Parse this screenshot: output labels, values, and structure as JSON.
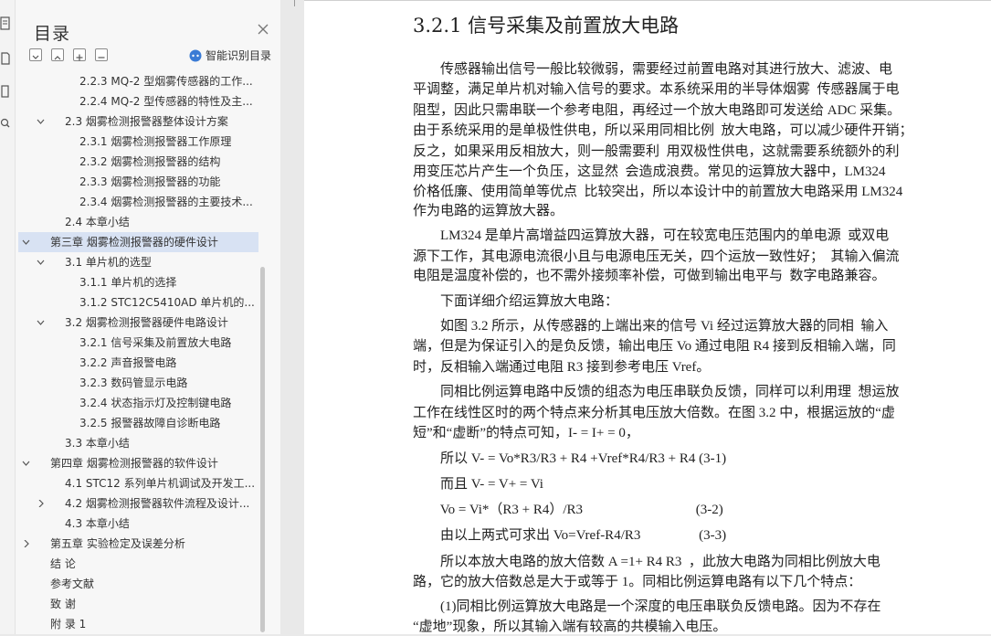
{
  "sidebar": {
    "title": "目录",
    "smart_label": "智能识别目录",
    "items": [
      {
        "label": "2.2.3 MQ-2 型烟雾传感器的工作...",
        "level": 3
      },
      {
        "label": "2.2.4 MQ-2 型传感器的特性及主...",
        "level": 3
      },
      {
        "label": "2.3 烟雾检测报警器整体设计方案",
        "level": 2,
        "expanded": true
      },
      {
        "label": "2.3.1 烟雾检测报警器工作原理",
        "level": 3
      },
      {
        "label": "2.3.2 烟雾检测报警器的结构",
        "level": 3
      },
      {
        "label": "2.3.3 烟雾检测报警器的功能",
        "level": 3
      },
      {
        "label": "2.3.4 烟雾检测报警器的主要技术...",
        "level": 3
      },
      {
        "label": "2.4 本章小结",
        "level": 2
      },
      {
        "label": "第三章  烟雾检测报警器的硬件设计",
        "level": 1,
        "expanded": true,
        "selected": true
      },
      {
        "label": "3.1 单片机的选型",
        "level": 2,
        "expanded": true
      },
      {
        "label": "3.1.1 单片机的选择",
        "level": 3
      },
      {
        "label": "3.1.2 STC12C5410AD 单片机的...",
        "level": 3
      },
      {
        "label": "3.2 烟雾检测报警器硬件电路设计",
        "level": 2,
        "expanded": true
      },
      {
        "label": "3.2.1 信号采集及前置放大电路",
        "level": 3
      },
      {
        "label": "3.2.2 声音报警电路",
        "level": 3
      },
      {
        "label": "3.2.3 数码管显示电路",
        "level": 3
      },
      {
        "label": "3.2.4 状态指示灯及控制键电路",
        "level": 3
      },
      {
        "label": "3.2.5 报警器故障自诊断电路",
        "level": 3
      },
      {
        "label": "3.3 本章小结",
        "level": 2
      },
      {
        "label": "第四章  烟雾检测报警器的软件设计",
        "level": 1,
        "expanded": true
      },
      {
        "label": "4.1 STC12 系列单片机调试及开发工...",
        "level": 2
      },
      {
        "label": "4.2 烟雾检测报警器软件流程及设计...",
        "level": 2,
        "collapsed": true
      },
      {
        "label": "4.3 本章小结",
        "level": 2
      },
      {
        "label": "第五章  实验检定及误差分析",
        "level": 1,
        "collapsed": true
      },
      {
        "label": "结  论",
        "level": 1
      },
      {
        "label": "参考文献",
        "level": 1
      },
      {
        "label": "致  谢",
        "level": 1
      },
      {
        "label": "附  录 1",
        "level": 1
      }
    ]
  },
  "document": {
    "heading": "3.2.1 信号采集及前置放大电路",
    "paragraph_lines": [
      "        传感器输出信号一般比较微弱，需要经过前置电路对其进行放大、滤波、电",
      "平调整，满足单片机对输入信号的要求。本系统采用的半导体烟雾  传感器属于电",
      "阻型，因此只需串联一个参考电阻，再经过一个放大电路即可发送给 ADC 采集。",
      "由于系统采用的是单极性供电，所以采用同相比例  放大电路，可以减少硬件开销；",
      "反之，如果采用反相放大，则一般需要利  用双极性供电，这就需要系统额外的利",
      "用变压芯片产生一个负压，这显然  会造成浪费。常见的运算放大器中，LM324",
      "价格低廉、使用简单等优点  比较突出，所以本设计中的前置放大电路采用 LM324",
      "作为电路的运算放大器。",
      "        LM324 是单片高增益四运算放大器，可在较宽电压范围内的单电源  或双电",
      "源下工作，其电源电流很小且与电源电压无关，四个运放一致性好；  其输入偏流",
      "电阻是温度补偿的，也不需外接频率补偿，可做到输出电平与  数字电路兼容。",
      "        下面详细介绍运算放大电路：",
      "        如图 3.2 所示，从传感器的上端出来的信号 Vi 经过运算放大器的同相  输入",
      "端，但是为保证引入的是负反馈，输出电压 Vo 通过电阻 R4 接到反相输入端，同",
      "时，反相输入端通过电阻 R3 接到参考电压 Vref。",
      "        同相比例运算电路中反馈的组态为电压串联负反馈，同样可以利用理  想运放",
      "工作在线性区时的两个特点来分析其电压放大倍数。在图 3.2 中，根据运放的“虚",
      "短”和“虚断”的特点可知，I- = I+ = 0，",
      "        所以 V- = Vo*R3/R3 + R4 +Vref*R4/R3 + R4 (3-1)",
      "        而且 V- = V+ = Vi",
      "        Vo = Vi*（R3 + R4）/R3                                 (3-2)",
      "        由以上两式可求出 Vo=Vref-R4/R3                 (3-3)",
      "        所以本放大电路的放大倍数 A =1+ R4 R3  ，此放大电路为同相比例放大电",
      "路，它的放大倍数总是大于或等于 1。同相比例运算电路有以下几个特点：",
      "        (1)同相比例运算放大电路是一个深度的电压串联负反馈电路。因为不存在",
      "“虚地”现象，所以其输入端有较高的共模输入电压。"
    ]
  }
}
